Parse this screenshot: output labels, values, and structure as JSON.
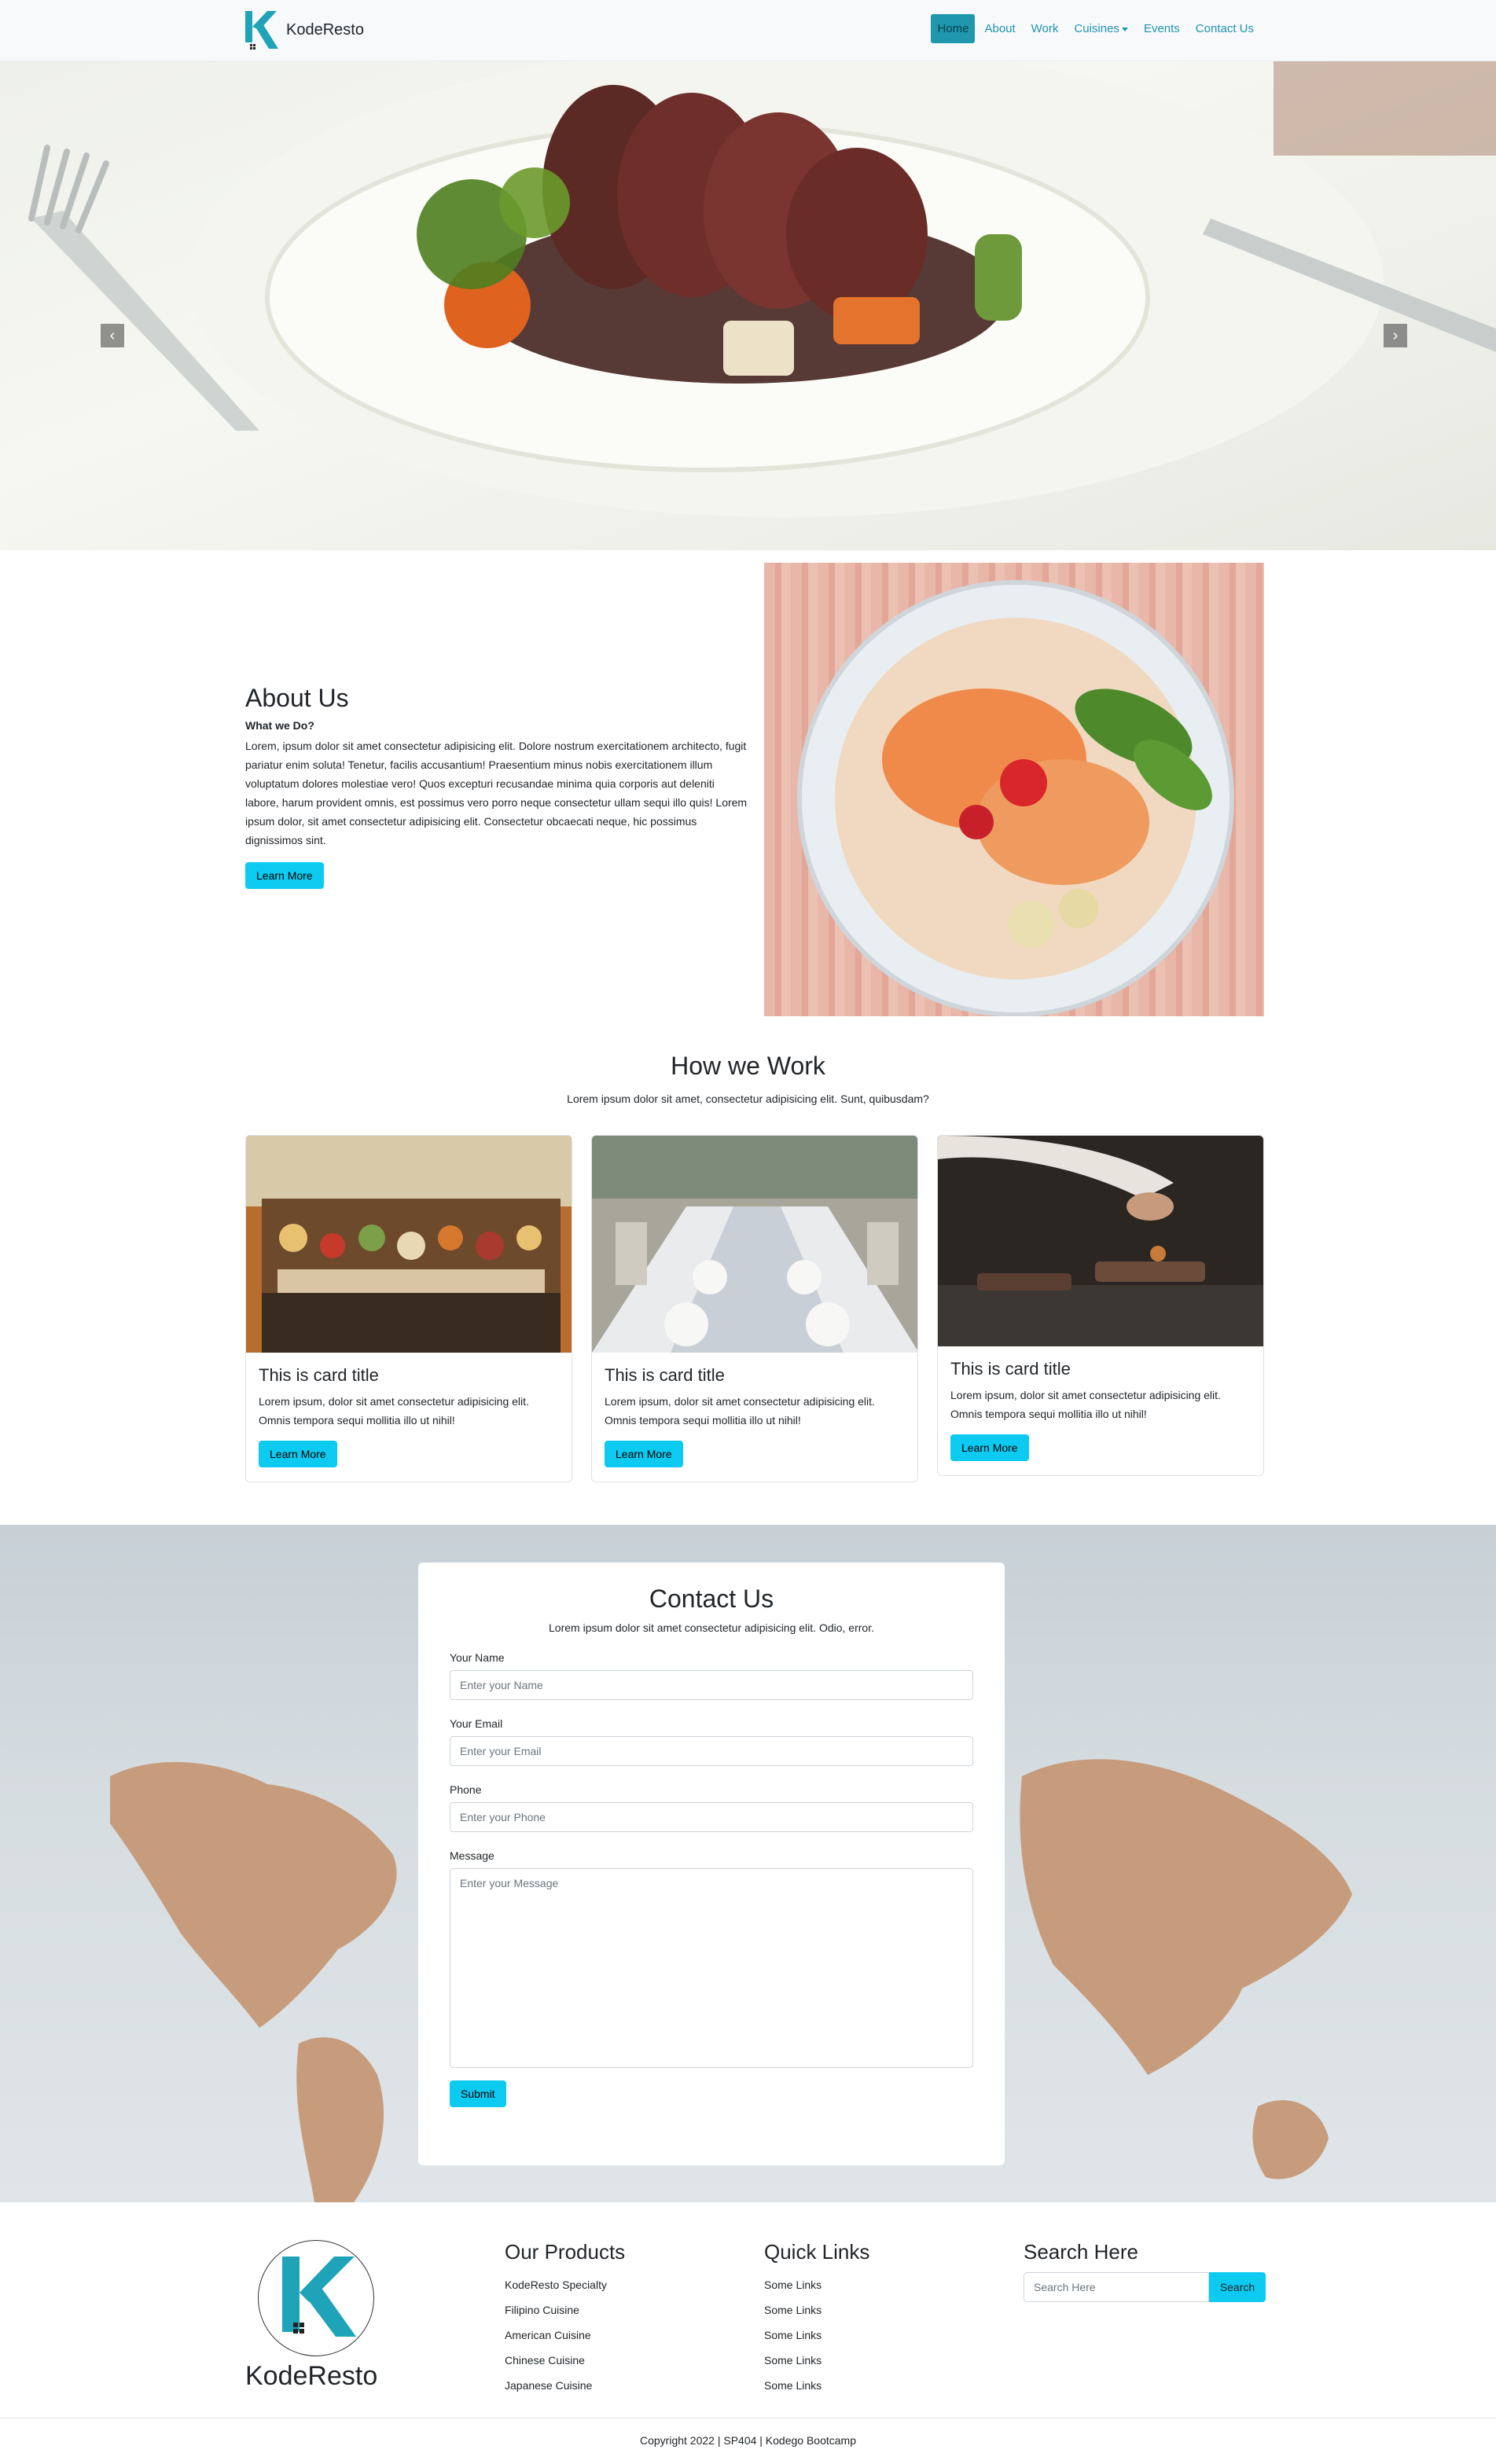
{
  "brand": {
    "name": "KodeResto"
  },
  "nav": {
    "items": [
      {
        "label": "Home",
        "active": true
      },
      {
        "label": "About"
      },
      {
        "label": "Work"
      },
      {
        "label": "Cuisines",
        "dropdown": true
      },
      {
        "label": "Events"
      },
      {
        "label": "Contact Us"
      }
    ]
  },
  "carousel": {
    "prev_icon": "chevron-left-icon",
    "next_icon": "chevron-right-icon"
  },
  "about": {
    "title": "About Us",
    "subtitle": "What we Do?",
    "body": "Lorem, ipsum dolor sit amet consectetur adipisicing elit. Dolore nostrum exercitationem architecto, fugit pariatur enim soluta! Tenetur, facilis accusantium! Praesentium minus nobis exercitationem illum voluptatum dolores molestiae vero! Quos excepturi recusandae minima quia corporis aut deleniti labore, harum provident omnis, est possimus vero porro neque consectetur ullam sequi illo quis! Lorem ipsum dolor, sit amet consectetur adipisicing elit. Consectetur obcaecati neque, hic possimus dignissimos sint.",
    "button": "Learn More"
  },
  "how": {
    "title": "How we Work",
    "subtitle": "Lorem ipsum dolor sit amet, consectetur adipisicing elit. Sunt, quibusdam?",
    "cards": [
      {
        "title": "This is card title",
        "text": "Lorem ipsum, dolor sit amet consectetur adipisicing elit. Omnis tempora sequi mollitia illo ut nihil!",
        "button": "Learn More"
      },
      {
        "title": "This is card title",
        "text": "Lorem ipsum, dolor sit amet consectetur adipisicing elit. Omnis tempora sequi mollitia illo ut nihil!",
        "button": "Learn More"
      },
      {
        "title": "This is card title",
        "text": "Lorem ipsum, dolor sit amet consectetur adipisicing elit. Omnis tempora sequi mollitia illo ut nihil!",
        "button": "Learn More"
      }
    ]
  },
  "contact": {
    "title": "Contact Us",
    "subtitle": "Lorem ipsum dolor sit amet consectetur adipisicing elit. Odio, error.",
    "name_label": "Your Name",
    "name_placeholder": "Enter your Name",
    "email_label": "Your Email",
    "email_placeholder": "Enter your Email",
    "phone_label": "Phone",
    "phone_placeholder": "Enter your Phone",
    "message_label": "Message",
    "message_placeholder": "Enter your Message",
    "submit": "Submit"
  },
  "footer": {
    "brand": "KodeResto",
    "products": {
      "title": "Our Products",
      "items": [
        "KodeResto Specialty",
        "Filipino Cuisine",
        "American Cuisine",
        "Chinese Cuisine",
        "Japanese Cuisine"
      ]
    },
    "links": {
      "title": "Quick Links",
      "items": [
        "Some Links",
        "Some Links",
        "Some Links",
        "Some Links",
        "Some Links"
      ]
    },
    "search": {
      "title": "Search Here",
      "placeholder": "Search Here",
      "button": "Search"
    },
    "copyright": "Copyright 2022 | SP404 | Kodego Bootcamp"
  },
  "colors": {
    "accent": "#0dcaf0",
    "brand_teal": "#1fa3b8",
    "nav_link": "#1f93b0"
  }
}
